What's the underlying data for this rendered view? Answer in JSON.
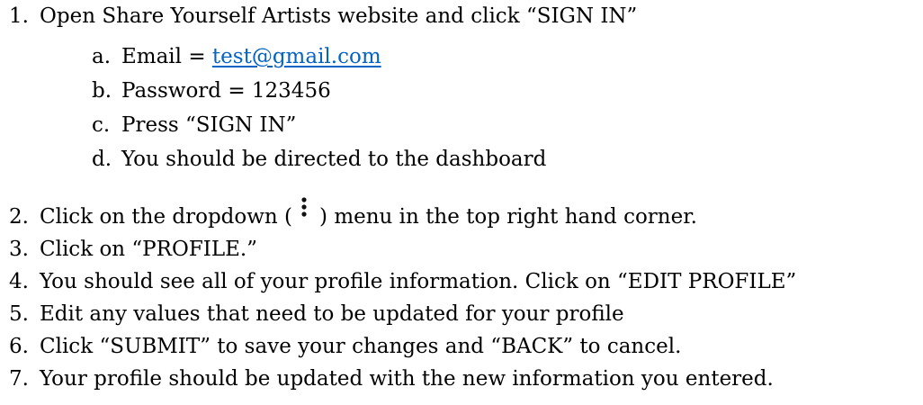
{
  "steps": [
    {
      "number": "1.",
      "text": "Open Share Yourself Artists website and click “SIGN IN”",
      "substeps": [
        {
          "letter": "a.",
          "prefix": "Email = ",
          "link": "test@gmail.com"
        },
        {
          "letter": "b.",
          "text": "Password = 123456"
        },
        {
          "letter": "c.",
          "text": "Press “SIGN IN”"
        },
        {
          "letter": "d.",
          "text": "You should be directed to the dashboard"
        }
      ]
    },
    {
      "number": "2.",
      "text_before": "Click on the dropdown (",
      "icon": "kebab-menu-icon",
      "text_after": ") menu in the top right hand corner."
    },
    {
      "number": "3.",
      "text": "Click on “PROFILE.”"
    },
    {
      "number": "4.",
      "text": "You should see all of your profile information. Click on “EDIT PROFILE”"
    },
    {
      "number": "5.",
      "text": "Edit any values that need to be updated for your profile"
    },
    {
      "number": "6.",
      "text": "Click “SUBMIT” to save your changes and “BACK” to cancel."
    },
    {
      "number": "7.",
      "text": "Your profile should be updated with the new information you entered."
    }
  ],
  "colors": {
    "text": "#000000",
    "link": "#0563c1"
  }
}
